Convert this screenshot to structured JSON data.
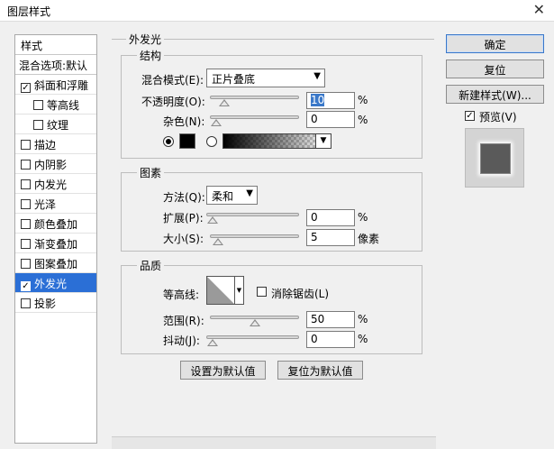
{
  "window": {
    "title": "图层样式",
    "close": "✕"
  },
  "sidebar": {
    "header": "样式",
    "blend_options": "混合选项:默认",
    "items": [
      {
        "label": "斜面和浮雕",
        "checked": true,
        "indent": false,
        "selected": false
      },
      {
        "label": "等高线",
        "checked": false,
        "indent": true,
        "selected": false
      },
      {
        "label": "纹理",
        "checked": false,
        "indent": true,
        "selected": false
      },
      {
        "label": "描边",
        "checked": false,
        "indent": false,
        "selected": false
      },
      {
        "label": "内阴影",
        "checked": false,
        "indent": false,
        "selected": false
      },
      {
        "label": "内发光",
        "checked": false,
        "indent": false,
        "selected": false
      },
      {
        "label": "光泽",
        "checked": false,
        "indent": false,
        "selected": false
      },
      {
        "label": "颜色叠加",
        "checked": false,
        "indent": false,
        "selected": false
      },
      {
        "label": "渐变叠加",
        "checked": false,
        "indent": false,
        "selected": false
      },
      {
        "label": "图案叠加",
        "checked": false,
        "indent": false,
        "selected": false
      },
      {
        "label": "外发光",
        "checked": true,
        "indent": false,
        "selected": true
      },
      {
        "label": "投影",
        "checked": false,
        "indent": false,
        "selected": false
      }
    ]
  },
  "panel": {
    "title": "外发光",
    "structure": {
      "legend": "结构",
      "blend_mode_label": "混合模式(E):",
      "blend_mode_value": "正片叠底",
      "opacity_label": "不透明度(O):",
      "opacity_value": "10",
      "opacity_level": 0.1,
      "noise_label": "杂色(N):",
      "noise_value": "0",
      "noise_level": 0,
      "percent": "%",
      "color_mode": "solid",
      "color": "#000000"
    },
    "elements": {
      "legend": "图素",
      "technique_label": "方法(Q):",
      "technique_value": "柔和",
      "spread_label": "扩展(P):",
      "spread_value": "0",
      "spread_level": 0,
      "size_label": "大小(S):",
      "size_value": "5",
      "size_level": 0.02,
      "percent": "%",
      "px_unit": "像素"
    },
    "quality": {
      "legend": "品质",
      "contour_label": "等高线:",
      "antialias_label": "消除锯齿(L)",
      "antialias_checked": false,
      "range_label": "范围(R):",
      "range_value": "50",
      "range_level": 0.5,
      "jitter_label": "抖动(J):",
      "jitter_value": "0",
      "jitter_level": 0,
      "percent": "%"
    },
    "set_default_label": "设置为默认值",
    "reset_default_label": "复位为默认值"
  },
  "buttons": {
    "ok": "确定",
    "reset": "复位",
    "new_style": "新建样式(W)...",
    "preview_label": "预览(V)",
    "preview_checked": true
  },
  "colors": {
    "selection": "#2b6fd6",
    "highlight": "#3a78c9"
  }
}
